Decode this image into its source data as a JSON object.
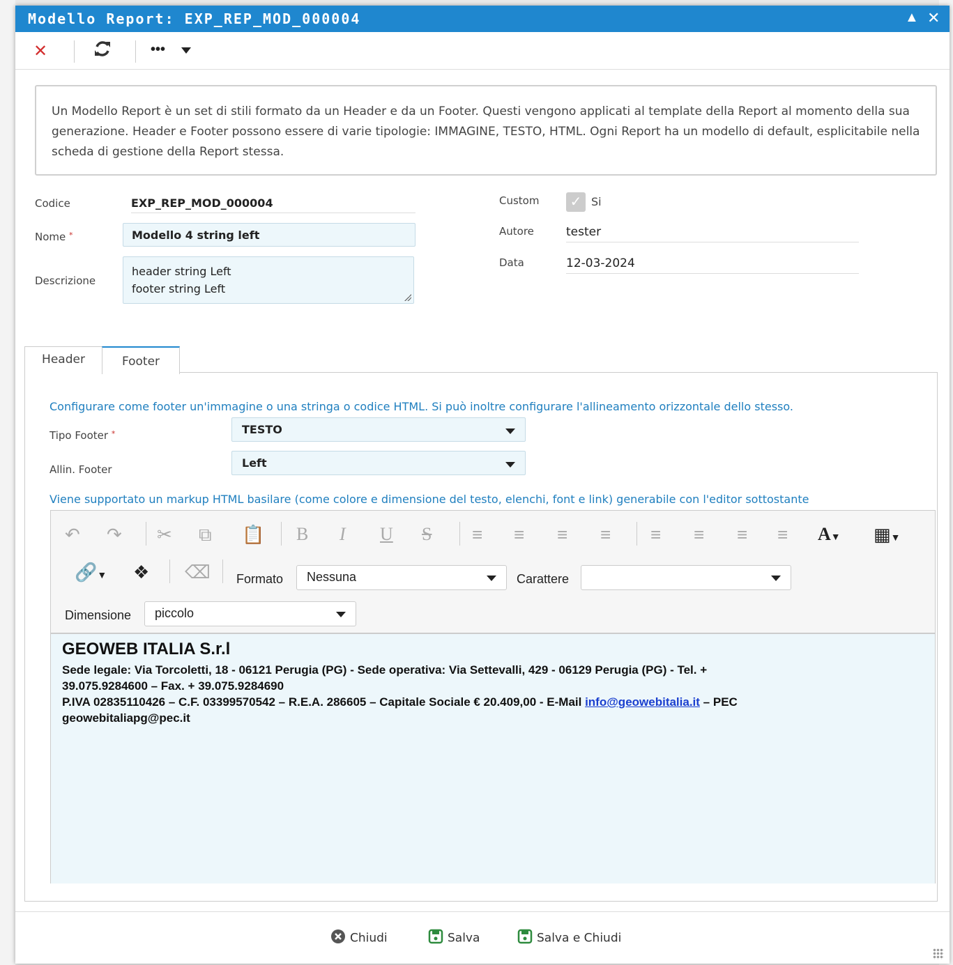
{
  "window": {
    "title": "Modello Report: EXP_REP_MOD_000004"
  },
  "info_text": "Un Modello Report è un set di stili formato da un Header e da un Footer. Questi vengono applicati al template della Report al momento della sua generazione. Header e Footer possono essere di varie tipologie: IMMAGINE, TESTO, HTML. Ogni Report ha un modello di default, esplicitabile nella scheda di gestione della Report stessa.",
  "form": {
    "codice_label": "Codice",
    "codice_value": "EXP_REP_MOD_000004",
    "nome_label": "Nome",
    "nome_value": "Modello 4 string left",
    "descrizione_label": "Descrizione",
    "descrizione_line1": "header string Left",
    "descrizione_line2": "footer string Left",
    "custom_label": "Custom",
    "custom_value": "Si",
    "autore_label": "Autore",
    "autore_value": "tester",
    "data_label": "Data",
    "data_value": "12-03-2024"
  },
  "tabs": [
    {
      "label": "Header"
    },
    {
      "label": "Footer"
    }
  ],
  "footer_tab": {
    "intro": "Configurare come footer un'immagine o una stringa o codice HTML. Si può inoltre configurare l'allineamento orizzontale dello stesso.",
    "tipo_label": "Tipo Footer",
    "tipo_value": "TESTO",
    "allin_label": "Allin. Footer",
    "allin_value": "Left",
    "markup_note": "Viene supportato un markup HTML basilare (come colore e dimensione del testo, elenchi, font e link) generabile con l'editor sottostante"
  },
  "editor": {
    "formato_label": "Formato",
    "formato_value": "Nessuna",
    "carattere_label": "Carattere",
    "carattere_value": "",
    "dimensione_label": "Dimensione",
    "dimensione_value": "piccolo",
    "content": {
      "company": "GEOWEB ITALIA S.r.l",
      "line1": "Sede legale: Via Torcoletti, 18 - 06121 Perugia (PG) - Sede operativa: Via Settevalli, 429 - 06129 Perugia (PG) - Tel. +",
      "line2": "39.075.9284600 – Fax. + 39.075.9284690",
      "line3_pre": "P.IVA 02835110426 – C.F. 03399570542 – R.E.A. 286605 – Capitale Sociale € 20.409,00 - E-Mail ",
      "line3_link": "info@geowebitalia.it",
      "line3_post": " – PEC",
      "line4": "geowebitaliapg@pec.it"
    }
  },
  "buttons": {
    "chiudi": "Chiudi",
    "salva": "Salva",
    "salva_chiudi": "Salva e Chiudi"
  },
  "colors": {
    "accent": "#1f87cf",
    "input_bg": "#edf7fb",
    "close_red": "#d32f2f"
  }
}
